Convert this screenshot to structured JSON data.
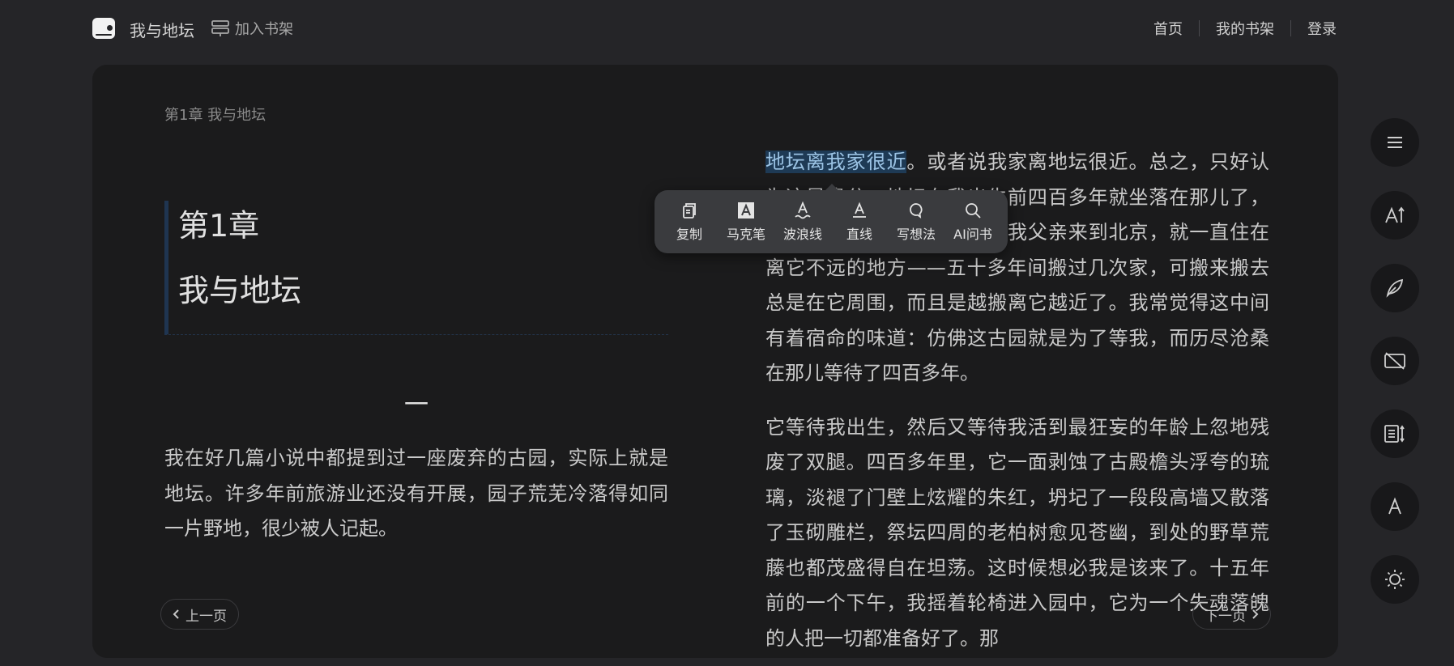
{
  "header": {
    "book_title": "我与地坛",
    "add_to_shelf": "加入书架",
    "nav": {
      "home": "首页",
      "my_shelf": "我的书架",
      "login": "登录"
    }
  },
  "reader": {
    "chapter_crumb": "第1章 我与地坛",
    "chapter_number": "第1章",
    "chapter_title": "我与地坛",
    "section_mark": "一",
    "left_paragraph": "我在好几篇小说中都提到过一座废弃的古园，实际上就是地坛。许多年前旅游业还没有开展，园子荒芜冷落得如同一片野地，很少被人记起。",
    "right_paragraph_1": {
      "highlighted": "地坛离我家很近",
      "rest": "。或者说我家离地坛很近。总之，只好认为这是缘分。地坛在我出生前四百多年就坐落在那儿了，而自从我的祖母年轻时带着我父亲来到北京，就一直住在离它不远的地方——五十多年间搬过几次家，可搬来搬去总是在它周围，而且是越搬离它越近了。我常觉得这中间有着宿命的味道：仿佛这古园就是为了等我，而历尽沧桑在那儿等待了四百多年。"
    },
    "right_paragraph_2": "它等待我出生，然后又等待我活到最狂妄的年龄上忽地残废了双腿。四百多年里，它一面剥蚀了古殿檐头浮夸的琉璃，淡褪了门壁上炫耀的朱红，坍圮了一段段高墙又散落了玉砌雕栏，祭坛四周的老柏树愈见苍幽，到处的野草荒藤也都茂盛得自在坦荡。这时候想必我是该来了。十五年前的一个下午，我摇着轮椅进入园中，它为一个失魂落魄的人把一切都准备好了。那",
    "prev_page": "上一页",
    "next_page": "下一页"
  },
  "selection_toolbar": {
    "copy": "复制",
    "marker": "马克笔",
    "wavy_line": "波浪线",
    "straight_line": "直线",
    "write_idea": "写想法",
    "ai_ask": "AI问书"
  },
  "side_tools": [
    "menu-icon",
    "font-size-icon",
    "pen-icon",
    "screen-off-icon",
    "auto-page-icon",
    "font-icon",
    "brightness-icon"
  ],
  "colors": {
    "page_bg": "#252528",
    "reader_bg": "#1b1b1c",
    "highlight_bg": "#1e3a55",
    "highlight_text": "#9bc3e4",
    "toolbar_bg": "#3a3b3e"
  }
}
